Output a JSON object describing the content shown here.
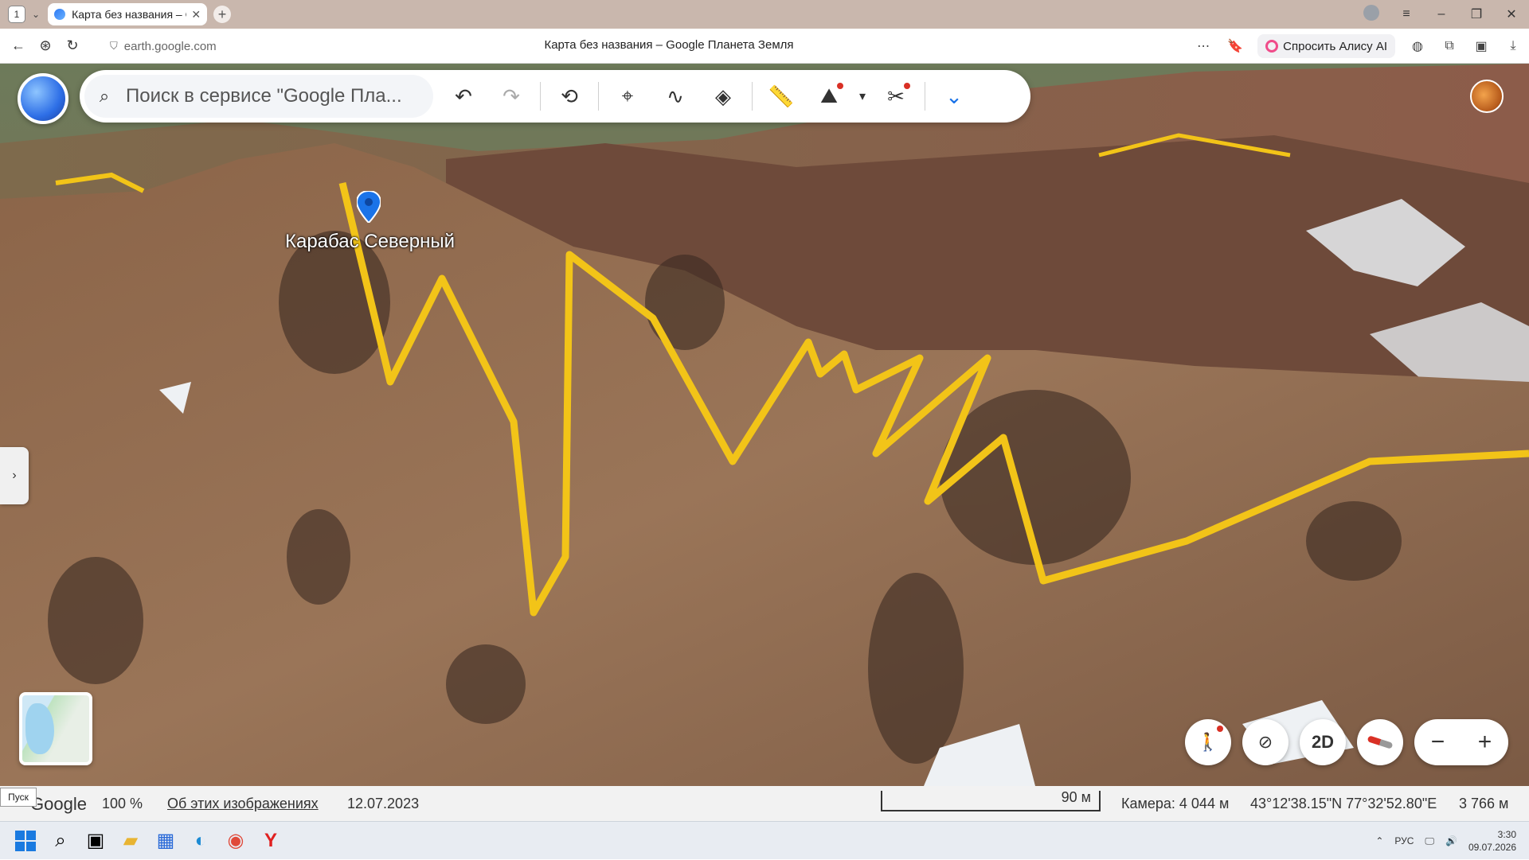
{
  "browser": {
    "tab_count": "1",
    "tab_title": "Карта без названия – G",
    "url": "earth.google.com",
    "page_title": "Карта без названия – Google Планета Земля",
    "alice_label": "Спросить Алису AI"
  },
  "toolbar": {
    "search_placeholder": "Поиск в сервисе \"Google Пла..."
  },
  "map": {
    "placemark_label": "Карабас Северный",
    "route_color": "#f2c418"
  },
  "controls": {
    "view_2d_label": "2D",
    "zoom_out": "−",
    "zoom_in": "+"
  },
  "status": {
    "logo": "Google",
    "zoom_pct": "100 %",
    "about_link": "Об этих изображениях",
    "date": "12.07.2023",
    "scale": "90 м",
    "camera": "Камера: 4 044 м",
    "coords": "43°12'38.15\"N 77°32'52.80\"E",
    "elevation": "3 766 м",
    "start_tooltip": "Пуск"
  },
  "taskbar": {
    "lang": "РУС",
    "time": "3:30",
    "date": "09.07.2026"
  }
}
